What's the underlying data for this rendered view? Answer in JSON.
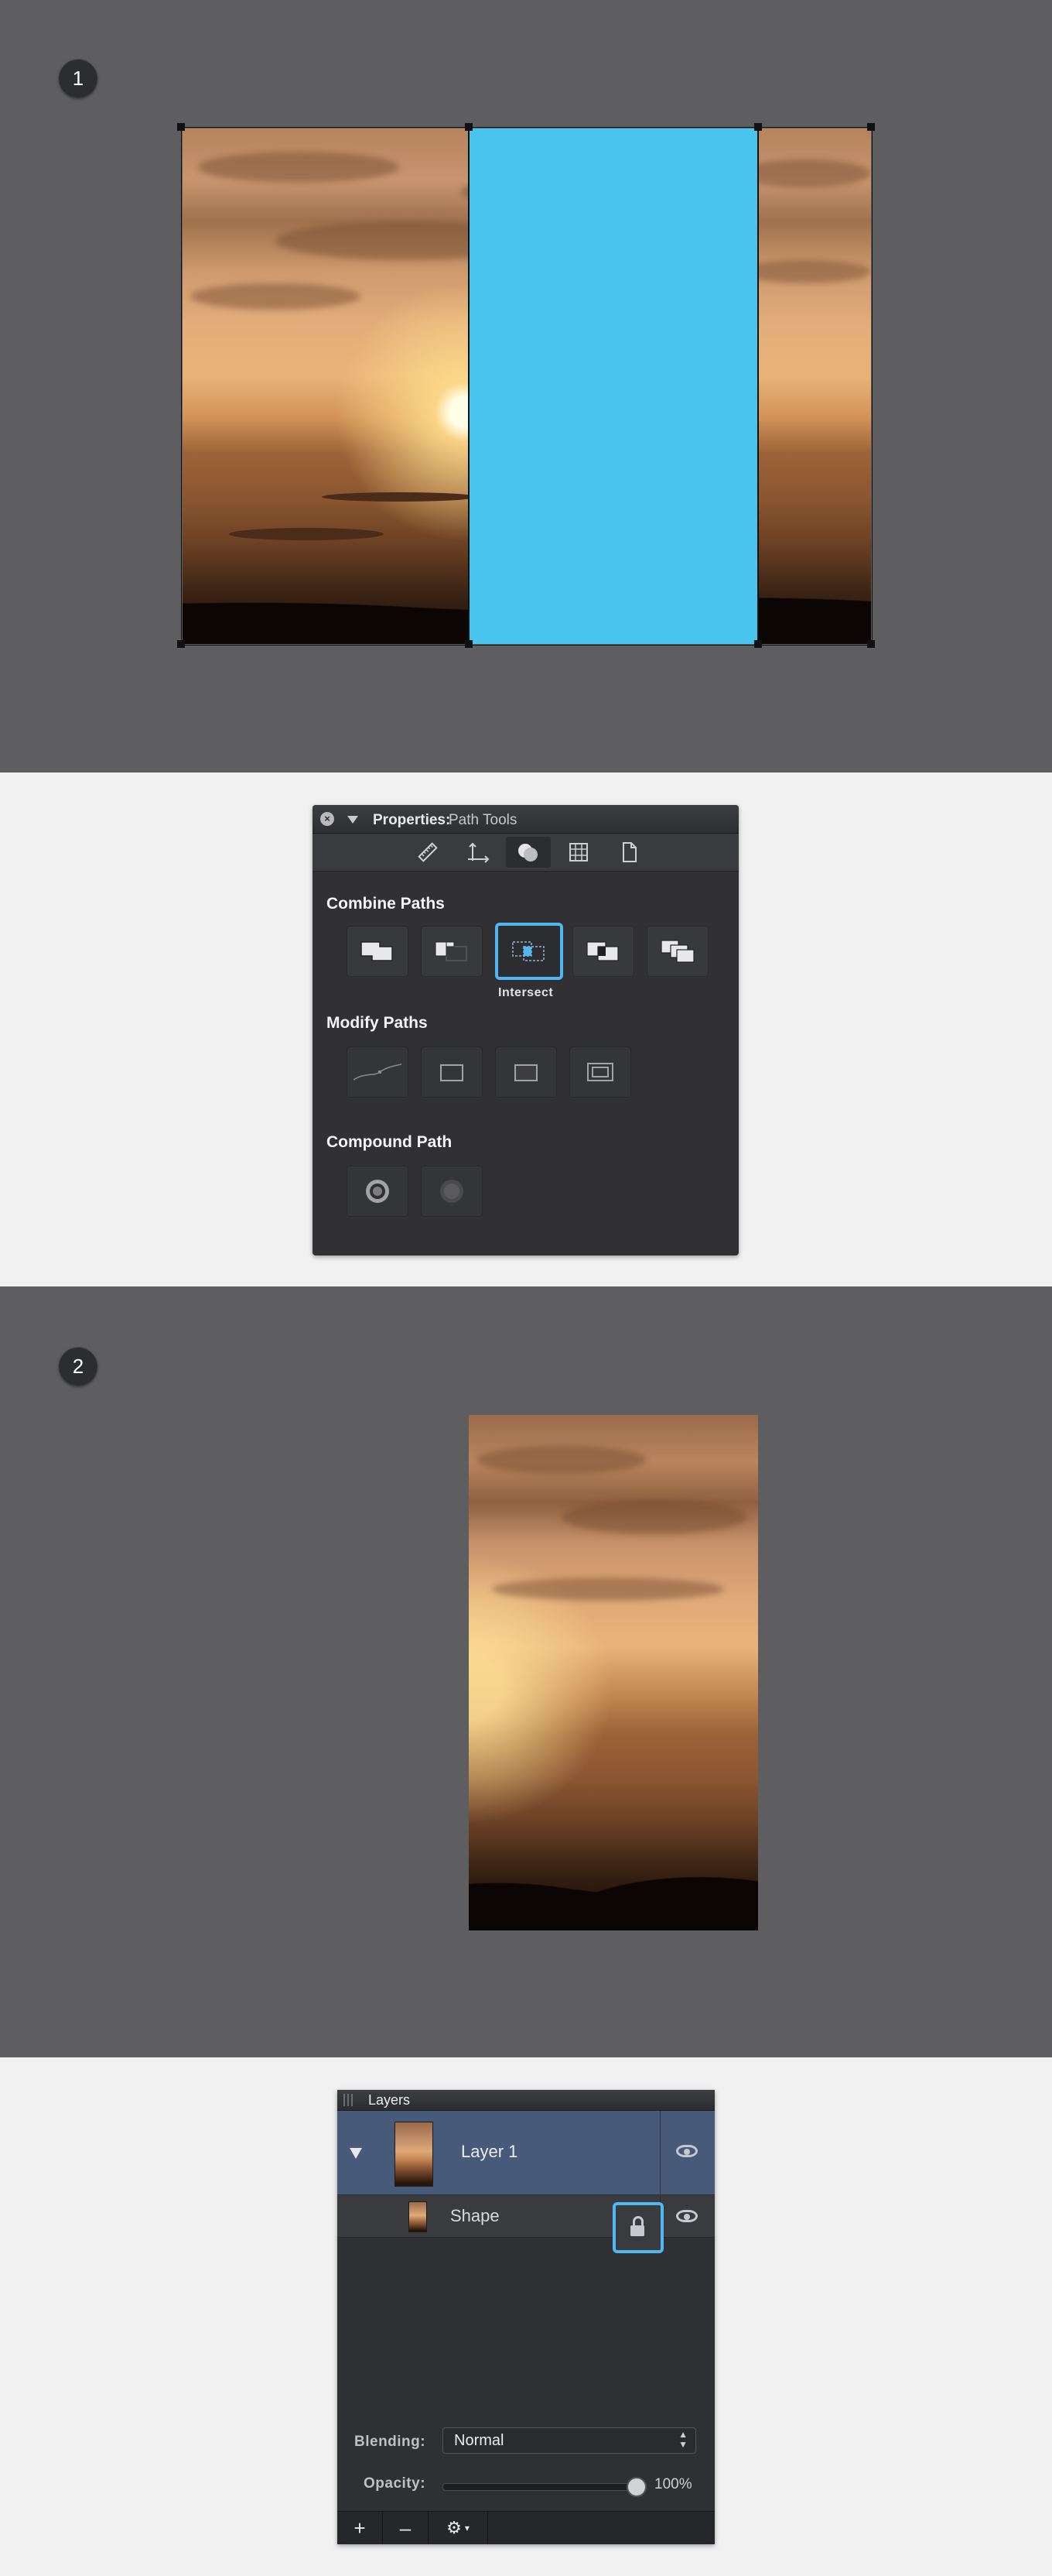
{
  "steps": {
    "one": "1",
    "two": "2"
  },
  "properties_panel": {
    "title": "Properties:",
    "subtitle": "Path Tools",
    "tab_icons": [
      "ruler-icon",
      "arrange-icon",
      "path-tools-icon",
      "grid-icon",
      "document-icon"
    ],
    "active_tab": "path-tools-icon",
    "combine_paths": {
      "title": "Combine Paths",
      "tools": [
        "union",
        "subtract",
        "intersect",
        "exclude",
        "divide"
      ],
      "selected": "intersect",
      "selected_caption": "Intersect"
    },
    "modify_paths": {
      "title": "Modify Paths",
      "tools": [
        "simplify",
        "outline",
        "fill",
        "stroke-to-path"
      ]
    },
    "compound_path": {
      "title": "Compound Path",
      "tools": [
        "make-compound",
        "release-compound"
      ]
    }
  },
  "layers_panel": {
    "title": "Layers",
    "layer": {
      "name": "Layer 1",
      "expanded": true,
      "visible": true
    },
    "shape": {
      "name": "Shape",
      "locked": true,
      "visible": true
    },
    "blending_label": "Blending:",
    "blending_value": "Normal",
    "opacity_label": "Opacity:",
    "opacity_value": "100%",
    "opacity_fraction": 1.0,
    "footer_buttons": {
      "add": "+",
      "remove": "–",
      "settings": "⚙"
    }
  },
  "colors": {
    "canvas": "#5e5e60",
    "highlight": "#4fb7f1",
    "blue_shape": "#48c4ee",
    "layer_selected": "#475a7a"
  }
}
